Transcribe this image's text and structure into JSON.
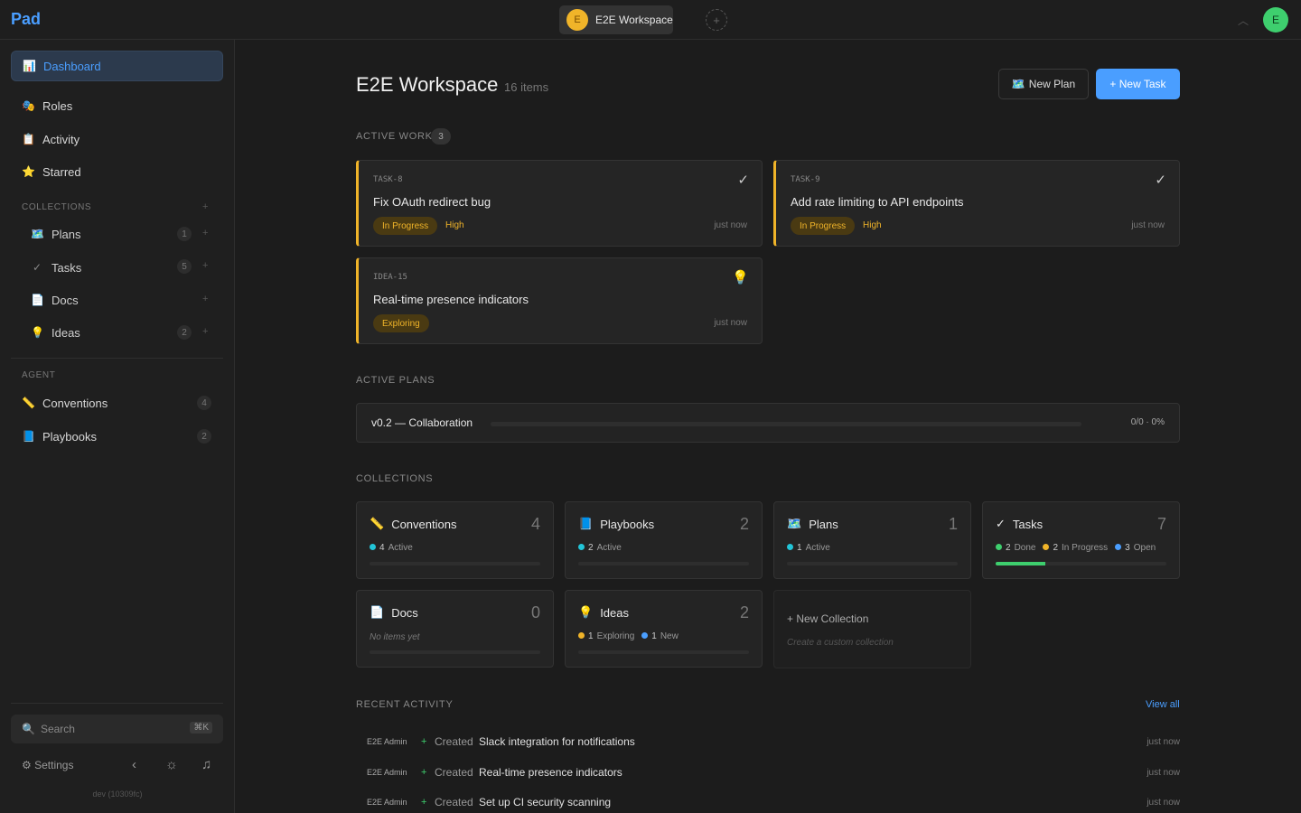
{
  "top": {
    "logo": "Pad",
    "workspace_initial": "E",
    "workspace_name": "E2E Workspace",
    "user_initial": "E"
  },
  "sidebar": {
    "nav": [
      {
        "icon": "📊",
        "label": "Dashboard"
      },
      {
        "icon": "🎭",
        "label": "Roles"
      },
      {
        "icon": "📋",
        "label": "Activity"
      },
      {
        "icon": "⭐",
        "label": "Starred"
      }
    ],
    "collections_label": "COLLECTIONS",
    "collections": [
      {
        "icon": "🗺️",
        "label": "Plans",
        "count": "1"
      },
      {
        "icon": "✓",
        "label": "Tasks",
        "count": "5"
      },
      {
        "icon": "📄",
        "label": "Docs",
        "count": ""
      },
      {
        "icon": "💡",
        "label": "Ideas",
        "count": "2"
      }
    ],
    "agent_label": "AGENT",
    "agent": [
      {
        "icon": "📏",
        "label": "Conventions",
        "count": "4"
      },
      {
        "icon": "📘",
        "label": "Playbooks",
        "count": "2"
      }
    ],
    "search_placeholder": "Search",
    "search_shortcut": "⌘K",
    "settings_label": "Settings",
    "version": "dev (10309fc)"
  },
  "main": {
    "title": "E2E Workspace",
    "count": "16 items",
    "new_plan": "New Plan",
    "new_task": "+ New Task",
    "active_work_label": "ACTIVE WORK",
    "active_work_count": "3",
    "cards": [
      {
        "id": "TASK-8",
        "mark": "✓",
        "title": "Fix OAuth redirect bug",
        "status": "In Progress",
        "priority": "High",
        "time": "just now"
      },
      {
        "id": "TASK-9",
        "mark": "✓",
        "title": "Add rate limiting to API endpoints",
        "status": "In Progress",
        "priority": "High",
        "time": "just now"
      },
      {
        "id": "IDEA-15",
        "mark": "💡",
        "title": "Real-time presence indicators",
        "status": "Exploring",
        "priority": "",
        "time": "just now"
      }
    ],
    "active_plans_label": "ACTIVE PLANS",
    "plan": {
      "name": "v0.2 — Collaboration",
      "progress_text": "0/0 · 0%",
      "progress": 0
    },
    "collections_label": "COLLECTIONS",
    "coll_cards": [
      {
        "icon": "📏",
        "name": "Conventions",
        "count": "4",
        "stats": [
          {
            "n": "4",
            "label": "Active",
            "color": "#22c5d8"
          }
        ],
        "fill": 0
      },
      {
        "icon": "📘",
        "name": "Playbooks",
        "count": "2",
        "stats": [
          {
            "n": "2",
            "label": "Active",
            "color": "#22c5d8"
          }
        ],
        "fill": 0
      },
      {
        "icon": "🗺️",
        "name": "Plans",
        "count": "1",
        "stats": [
          {
            "n": "1",
            "label": "Active",
            "color": "#22c5d8"
          }
        ],
        "fill": 0
      },
      {
        "icon": "✓",
        "name": "Tasks",
        "count": "7",
        "stats": [
          {
            "n": "2",
            "label": "Done",
            "color": "#3ecf6e"
          },
          {
            "n": "2",
            "label": "In Progress",
            "color": "#f0b429"
          },
          {
            "n": "3",
            "label": "Open",
            "color": "#4a9eff"
          }
        ],
        "fill": 0.29
      },
      {
        "icon": "📄",
        "name": "Docs",
        "count": "0",
        "empty": "No items yet",
        "stats": [],
        "fill": 0
      },
      {
        "icon": "💡",
        "name": "Ideas",
        "count": "2",
        "stats": [
          {
            "n": "1",
            "label": "Exploring",
            "color": "#f0b429"
          },
          {
            "n": "1",
            "label": "New",
            "color": "#4a9eff"
          }
        ],
        "fill": 0
      }
    ],
    "new_collection": {
      "title": "+  New Collection",
      "subtitle": "Create a custom collection"
    },
    "recent_label": "RECENT ACTIVITY",
    "view_all": "View all",
    "activity": [
      {
        "user": "E2E Admin",
        "verb": "Created",
        "item": "Slack integration for notifications",
        "time": "just now"
      },
      {
        "user": "E2E Admin",
        "verb": "Created",
        "item": "Real-time presence indicators",
        "time": "just now"
      },
      {
        "user": "E2E Admin",
        "verb": "Created",
        "item": "Set up CI security scanning",
        "time": "just now"
      }
    ]
  },
  "colors": {
    "accent": "#4a9eff",
    "warning": "#f0b429",
    "success": "#3ecf6e"
  }
}
